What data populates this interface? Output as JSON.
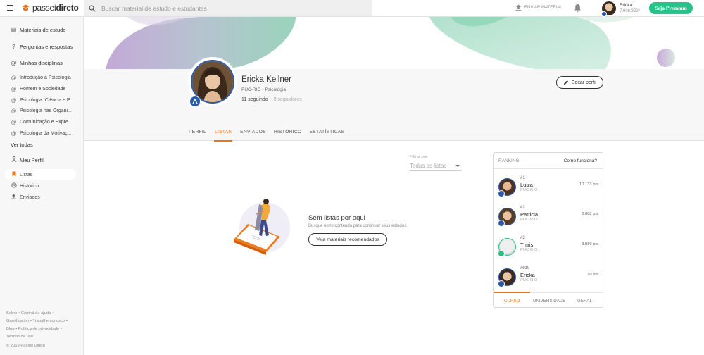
{
  "topbar": {
    "logo_text_light": "passei",
    "logo_text_bold": "direto",
    "search_placeholder": "Buscar material de estudo e estudantes",
    "send_label": "ENVIAR MATERIAL",
    "user_name": "Ericka",
    "user_points": "7.908.392º",
    "premium_label": "Seja Premium"
  },
  "sidebar": {
    "materials": "Materiais de estudo",
    "questions": "Perguntas e respostas",
    "disciplines_title": "Minhas disciplinas",
    "disciplines": [
      "Introdução à Psicologia",
      "Homem e Sociedade",
      "Psicologia: Ciência e P...",
      "Psicologia nas Organi...",
      "Comunicação e Expre...",
      "Psicologia da Motivaç..."
    ],
    "see_all": "Ver todas",
    "profile_title": "Meu Perfil",
    "profile_items": [
      "Listas",
      "Histórico",
      "Enviados"
    ],
    "footer_lines": [
      "Sobre • Central de ajuda •",
      "Gamification • Trabalhe conosco •",
      "Blog • Política de privacidade •",
      "Termos de uso"
    ],
    "copyright": "© 2019 Passei Direto"
  },
  "profile": {
    "name": "Ericka Kellner",
    "university": "PUC-RIO • Psicologia",
    "following": "11 seguindo",
    "followers": "0 seguidores",
    "edit_label": "Editar perfil",
    "tabs": [
      "PERFIL",
      "LISTAS",
      "ENVIADOS",
      "HISTÓRICO",
      "ESTATÍSTICAS"
    ]
  },
  "filter": {
    "label": "Filtrar por",
    "value": "Todas as listas"
  },
  "empty": {
    "title": "Sem listas por aqui",
    "subtitle": "Busque outro conteúdo para continuar seus estudos.",
    "button": "Veja materiais recomendados"
  },
  "ranking": {
    "title": "RANKING",
    "link": "Como funciona?",
    "rows": [
      {
        "pos": "#1",
        "name": "Luiza",
        "uni": "PUC-RIO",
        "pts": "10.133 pts"
      },
      {
        "pos": "#2",
        "name": "Patricia",
        "uni": "PUC-RIO",
        "pts": "6.082 pts"
      },
      {
        "pos": "#3",
        "name": "Thais",
        "uni": "PUC-RIO",
        "pts": "3.980 pts"
      },
      {
        "pos": "#910",
        "name": "Ericka",
        "uni": "PUC-RIO",
        "pts": "10 pts"
      }
    ],
    "tabs": [
      "CURSO",
      "UNIVERSIDADE",
      "GERAL"
    ]
  },
  "colors": {
    "accent": "#e8731a",
    "premium": "#27c28a",
    "badge_blue": "#2b5aa8"
  }
}
